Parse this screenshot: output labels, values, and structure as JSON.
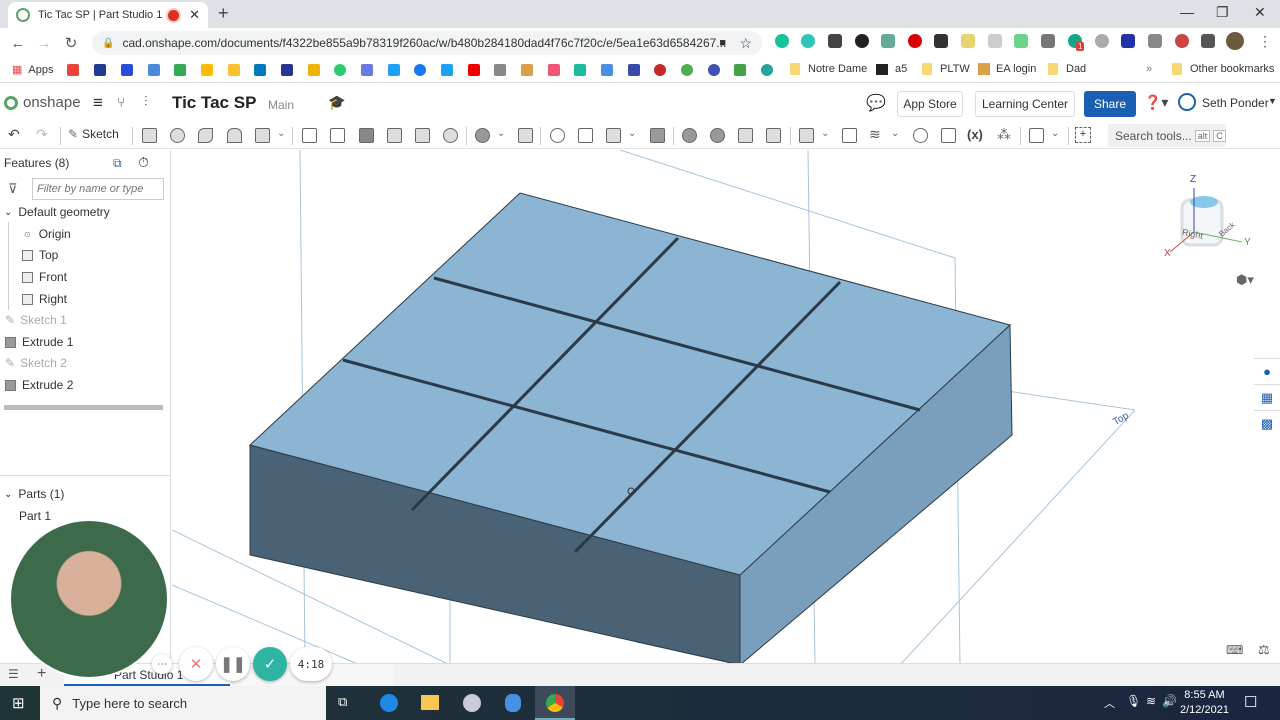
{
  "browser": {
    "tab_title": "Tic Tac SP | Part Studio 1",
    "url": "cad.onshape.com/documents/f4322be855a9b78319f260ac/w/b480b284180dad4f76c7f20c/e/5ea1e63d6584267...",
    "bookmarks": [
      "Apps",
      "Notre Dame",
      "a5",
      "PLTW",
      "EA login",
      "Dad",
      "Other bookmarks"
    ],
    "extension_badge": "1"
  },
  "app": {
    "brand": "onshape",
    "doc_title": "Tic Tac SP",
    "workspace": "Main",
    "app_store": "App Store",
    "learning_center": "Learning Center",
    "share": "Share",
    "user": "Seth Ponder"
  },
  "toolbar": {
    "sketch": "Sketch",
    "search_tools": "Search tools...",
    "shortcut_alt": "alt",
    "shortcut_key": "C",
    "variable_label": "(x)"
  },
  "features": {
    "title": "Features (8)",
    "filter_placeholder": "Filter by name or type",
    "default_geometry": "Default geometry",
    "items": [
      {
        "label": "Origin",
        "dim": false
      },
      {
        "label": "Top",
        "dim": false
      },
      {
        "label": "Front",
        "dim": false
      },
      {
        "label": "Right",
        "dim": false
      },
      {
        "label": "Sketch 1",
        "dim": true
      },
      {
        "label": "Extrude 1",
        "dim": false
      },
      {
        "label": "Sketch 2",
        "dim": true
      },
      {
        "label": "Extrude 2",
        "dim": false
      }
    ],
    "parts_title": "Parts (1)",
    "parts": [
      "Part 1"
    ]
  },
  "viewcube": {
    "z": "Z",
    "x": "X",
    "y": "Y",
    "face_right": "Right",
    "face_back": "Back"
  },
  "viewport": {
    "plane_label": "Top"
  },
  "bottom": {
    "tab_label": "Part Studio 1"
  },
  "recorder": {
    "time": "4:18"
  },
  "taskbar": {
    "search": "Type here to search",
    "time": "8:55 AM",
    "date": "2/12/2021"
  }
}
